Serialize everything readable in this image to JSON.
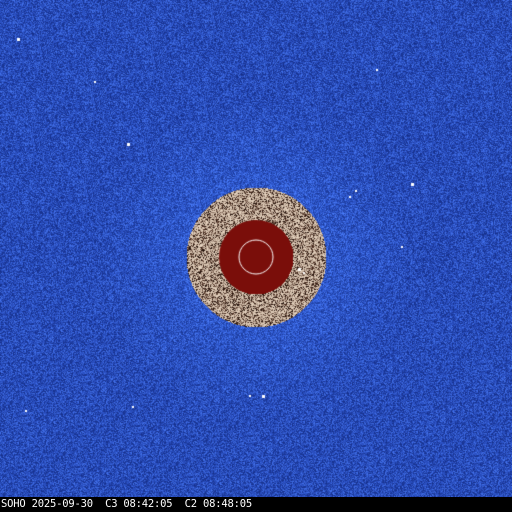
{
  "image": {
    "caption": "SOHO 2025-09-30  C3 08:42:05  C2 08:48:05"
  },
  "colors": {
    "sky": "#2a4fc0",
    "sky_light": "#3e6ae0",
    "sky_dark": "#1a3696",
    "inner_field_light": "#e8d6c2",
    "inner_field_dark": "#3a1c10",
    "occulter": "#7a0e0a",
    "sun_outline": "#ffffff",
    "caption_bar": "#000000",
    "caption_text": "#ffffff"
  }
}
